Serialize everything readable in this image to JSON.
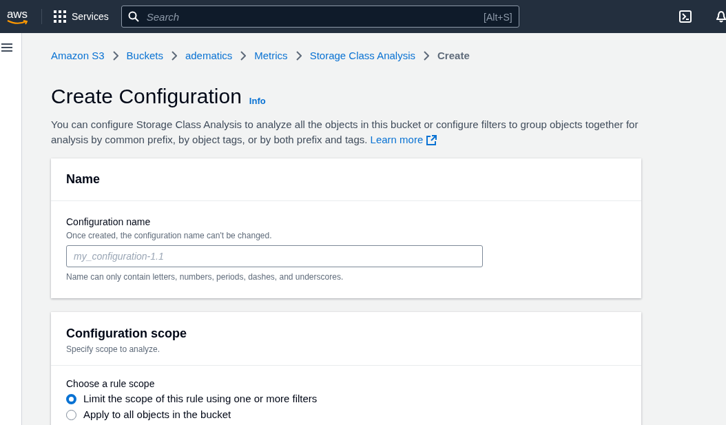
{
  "top_bar": {
    "logo": "aws",
    "services": "Services",
    "search": {
      "placeholder": "Search",
      "shortcut": "[Alt+S]"
    }
  },
  "breadcrumbs": [
    {
      "label": "Amazon S3",
      "link": true
    },
    {
      "label": "Buckets",
      "link": true
    },
    {
      "label": "adematics",
      "link": true
    },
    {
      "label": "Metrics",
      "link": true
    },
    {
      "label": "Storage Class Analysis",
      "link": true
    },
    {
      "label": "Create",
      "link": false
    }
  ],
  "page": {
    "title": "Create Configuration",
    "info": "Info",
    "description": "You can configure Storage Class Analysis to analyze all the objects in this bucket or configure filters to group objects together for analysis by common prefix, by object tags, or by both prefix and tags.",
    "learn_more": "Learn more"
  },
  "name_panel": {
    "title": "Name",
    "field": {
      "label": "Configuration name",
      "description": "Once created, the configuration name can't be changed.",
      "placeholder": "my_configuration-1.1",
      "constraint": "Name can only contain letters, numbers, periods, dashes, and underscores."
    }
  },
  "scope_panel": {
    "title": "Configuration scope",
    "subtitle": "Specify scope to analyze.",
    "group_label": "Choose a rule scope",
    "options": [
      {
        "label": "Limit the scope of this rule using one or more filters",
        "selected": true
      },
      {
        "label": "Apply to all objects in the bucket",
        "selected": false
      }
    ]
  }
}
